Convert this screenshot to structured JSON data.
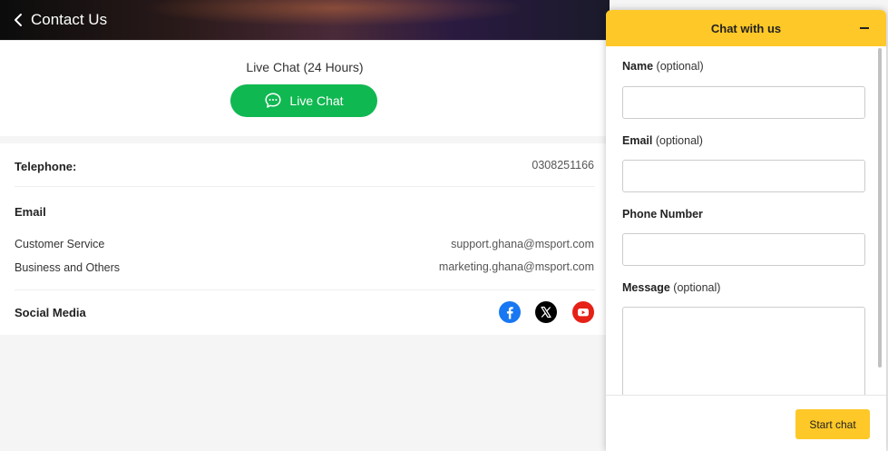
{
  "header": {
    "title": "Contact Us",
    "back_icon": "chevron-left-icon"
  },
  "live_chat": {
    "caption": "Live Chat (24 Hours)",
    "button_label": "Live Chat",
    "button_icon": "chat-bubble-icon",
    "color": "#10b851"
  },
  "telephone": {
    "label": "Telephone:",
    "value": "0308251166"
  },
  "email": {
    "heading": "Email",
    "rows": [
      {
        "label": "Customer Service",
        "value": "support.ghana@msport.com"
      },
      {
        "label": "Business and Others",
        "value": "marketing.ghana@msport.com"
      }
    ]
  },
  "social": {
    "heading": "Social Media",
    "icons": [
      {
        "name": "facebook-icon",
        "color": "#1877f2"
      },
      {
        "name": "x-icon",
        "color": "#000000"
      },
      {
        "name": "youtube-icon",
        "color": "#e62117"
      }
    ]
  },
  "chat": {
    "title": "Chat with us",
    "minimize_icon": "minus-icon",
    "accent": "#fec828",
    "fields": {
      "name": {
        "label": "Name",
        "hint": "(optional)",
        "value": ""
      },
      "email": {
        "label": "Email",
        "hint": "(optional)",
        "value": ""
      },
      "phone": {
        "label": "Phone Number",
        "hint": "",
        "value": ""
      },
      "message": {
        "label": "Message",
        "hint": "(optional)",
        "value": ""
      }
    },
    "submit_label": "Start chat"
  }
}
